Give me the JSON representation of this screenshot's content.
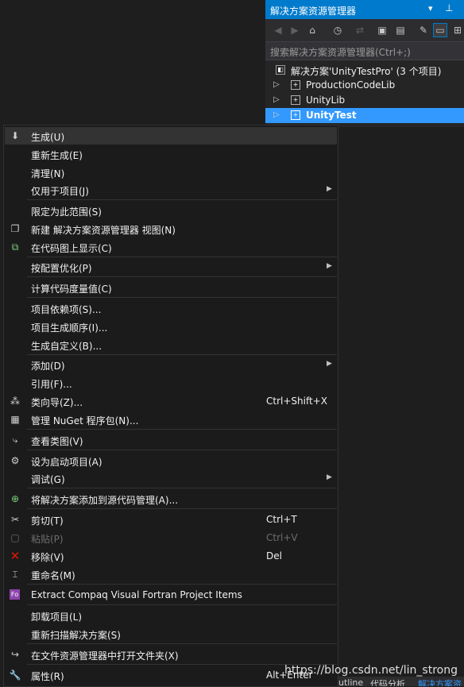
{
  "solution_explorer": {
    "title": "解决方案资源管理器",
    "search_placeholder": "搜索解决方案资源管理器(Ctrl+;)",
    "solution_label": "解决方案'UnityTestPro' (3 个项目)",
    "projects": [
      {
        "name": "ProductionCodeLib",
        "selected": false
      },
      {
        "name": "UnityLib",
        "selected": false
      },
      {
        "name": "UnityTest",
        "selected": true
      }
    ]
  },
  "context_menu": {
    "items": [
      {
        "label": "生成(U)",
        "icon": "build-icon"
      },
      {
        "label": "重新生成(E)"
      },
      {
        "label": "清理(N)"
      },
      {
        "label": "仅用于项目(J)",
        "submenu": true
      },
      {
        "label": "限定为此范围(S)"
      },
      {
        "label": "新建 解决方案资源管理器 视图(N)",
        "icon": "new-view-icon"
      },
      {
        "label": "在代码图上显示(C)",
        "icon": "code-map-icon"
      },
      {
        "label": "按配置优化(P)",
        "submenu": true
      },
      {
        "label": "计算代码度量值(C)"
      },
      {
        "label": "项目依赖项(S)..."
      },
      {
        "label": "项目生成顺序(I)..."
      },
      {
        "label": "生成自定义(B)..."
      },
      {
        "label": "添加(D)",
        "submenu": true
      },
      {
        "label": "引用(F)..."
      },
      {
        "label": "类向导(Z)...",
        "shortcut": "Ctrl+Shift+X",
        "icon": "class-wizard-icon"
      },
      {
        "label": "管理 NuGet 程序包(N)...",
        "icon": "nuget-icon"
      },
      {
        "label": "查看类图(V)",
        "icon": "class-diagram-icon"
      },
      {
        "label": "设为启动项目(A)",
        "icon": "gear-icon"
      },
      {
        "label": "调试(G)",
        "submenu": true
      },
      {
        "label": "将解决方案添加到源代码管理(A)...",
        "icon": "source-control-icon"
      },
      {
        "label": "剪切(T)",
        "shortcut": "Ctrl+T",
        "icon": "scissors-icon"
      },
      {
        "label": "粘贴(P)",
        "shortcut": "Ctrl+V",
        "icon": "paste-icon",
        "disabled": true
      },
      {
        "label": "移除(V)",
        "shortcut": "Del",
        "icon": "remove-icon"
      },
      {
        "label": "重命名(M)",
        "icon": "rename-icon"
      },
      {
        "label": "Extract Compaq Visual Fortran Project Items",
        "icon": "fortran-icon"
      },
      {
        "label": "卸载项目(L)"
      },
      {
        "label": "重新扫描解决方案(S)"
      },
      {
        "label": "在文件资源管理器中打开文件夹(X)",
        "icon": "open-folder-icon"
      },
      {
        "label": "属性(R)",
        "shortcut": "Alt+Enter",
        "icon": "wrench-icon"
      }
    ]
  },
  "watermark": "https://blog.csdn.net/lin_strong",
  "bottom_tabs": [
    "utline",
    "代码分析",
    "解决方案资"
  ],
  "colors": {
    "accent": "#007acc",
    "selection": "#3399ff",
    "menu_bg": "#1b1b1c",
    "remove_icon": "#e51400"
  }
}
